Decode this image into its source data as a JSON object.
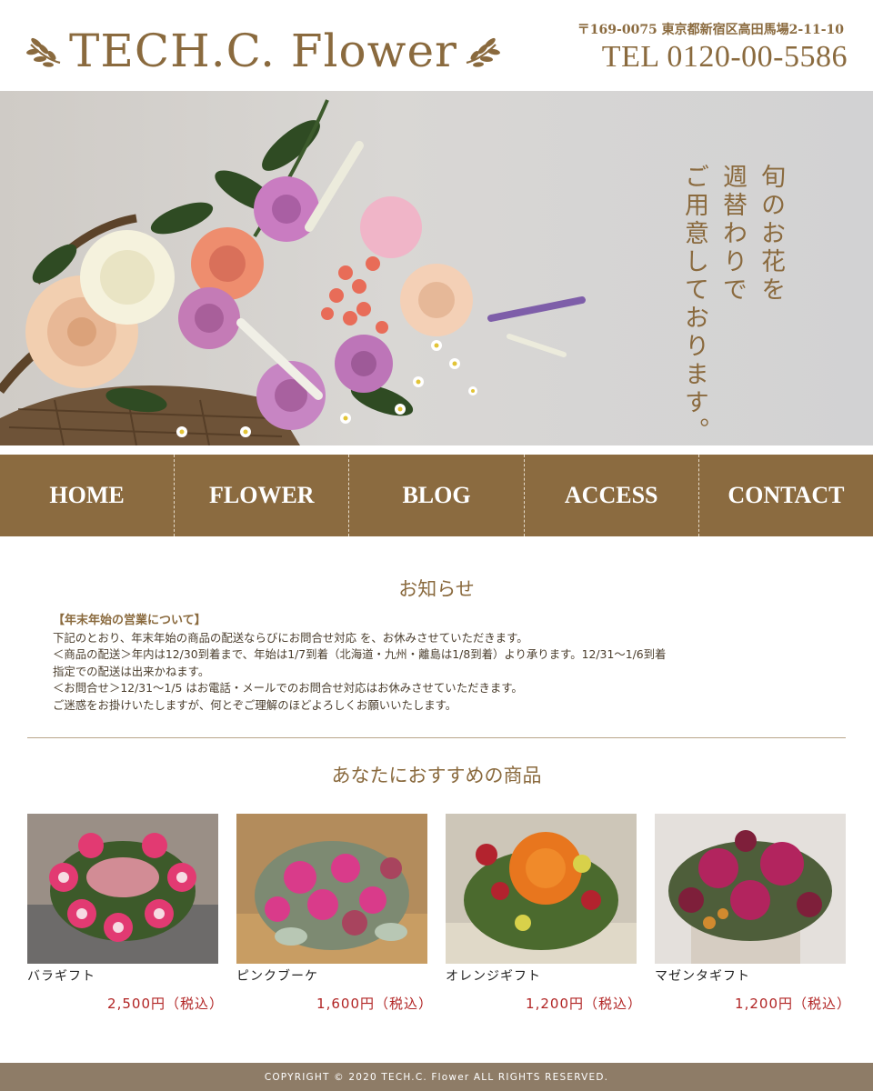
{
  "header": {
    "logo_text": "TECH.C. Flower",
    "address": "〒169-0075 東京都新宿区高田馬場2-11-10",
    "tel": "TEL 0120-00-5586"
  },
  "hero": {
    "tagline": [
      "旬のお花を",
      "週替わりで",
      "ご用意しております。"
    ]
  },
  "nav": {
    "items": [
      "HOME",
      "FLOWER",
      "BLOG",
      "ACCESS",
      "CONTACT"
    ]
  },
  "notice": {
    "title": "お知らせ",
    "heading": "【年末年始の営業について】",
    "lines": [
      "下記のとおり、年末年始の商品の配送ならびにお問合せ対応 を、お休みさせていただきます。",
      "＜商品の配送＞年内は12/30到着まで、年始は1/7到着（北海道・九州・離島は1/8到着）より承ります。12/31〜1/6到着",
      "指定での配送は出来かねます。",
      "＜お問合せ＞12/31〜1/5 はお電話・メールでのお問合せ対応はお休みさせていただきます。",
      "ご迷惑をお掛けいたしますが、何とぞご理解のほどよろしくお願いいたします。"
    ]
  },
  "recommend": {
    "title": "あなたにおすすめの商品",
    "products": [
      {
        "name": "バラギフト",
        "price": "2,500円（税込）"
      },
      {
        "name": "ピンクブーケ",
        "price": "1,600円（税込）"
      },
      {
        "name": "オレンジギフト",
        "price": "1,200円（税込）"
      },
      {
        "name": "マゼンタギフト",
        "price": "1,200円（税込）"
      }
    ]
  },
  "footer": {
    "copyright": "COPYRIGHT © 2020 TECH.C. Flower ALL RIGHTS RESERVED."
  },
  "colors": {
    "brand_brown": "#8b6b40",
    "price_red": "#b12424",
    "footer_bg": "#8e7c67"
  }
}
